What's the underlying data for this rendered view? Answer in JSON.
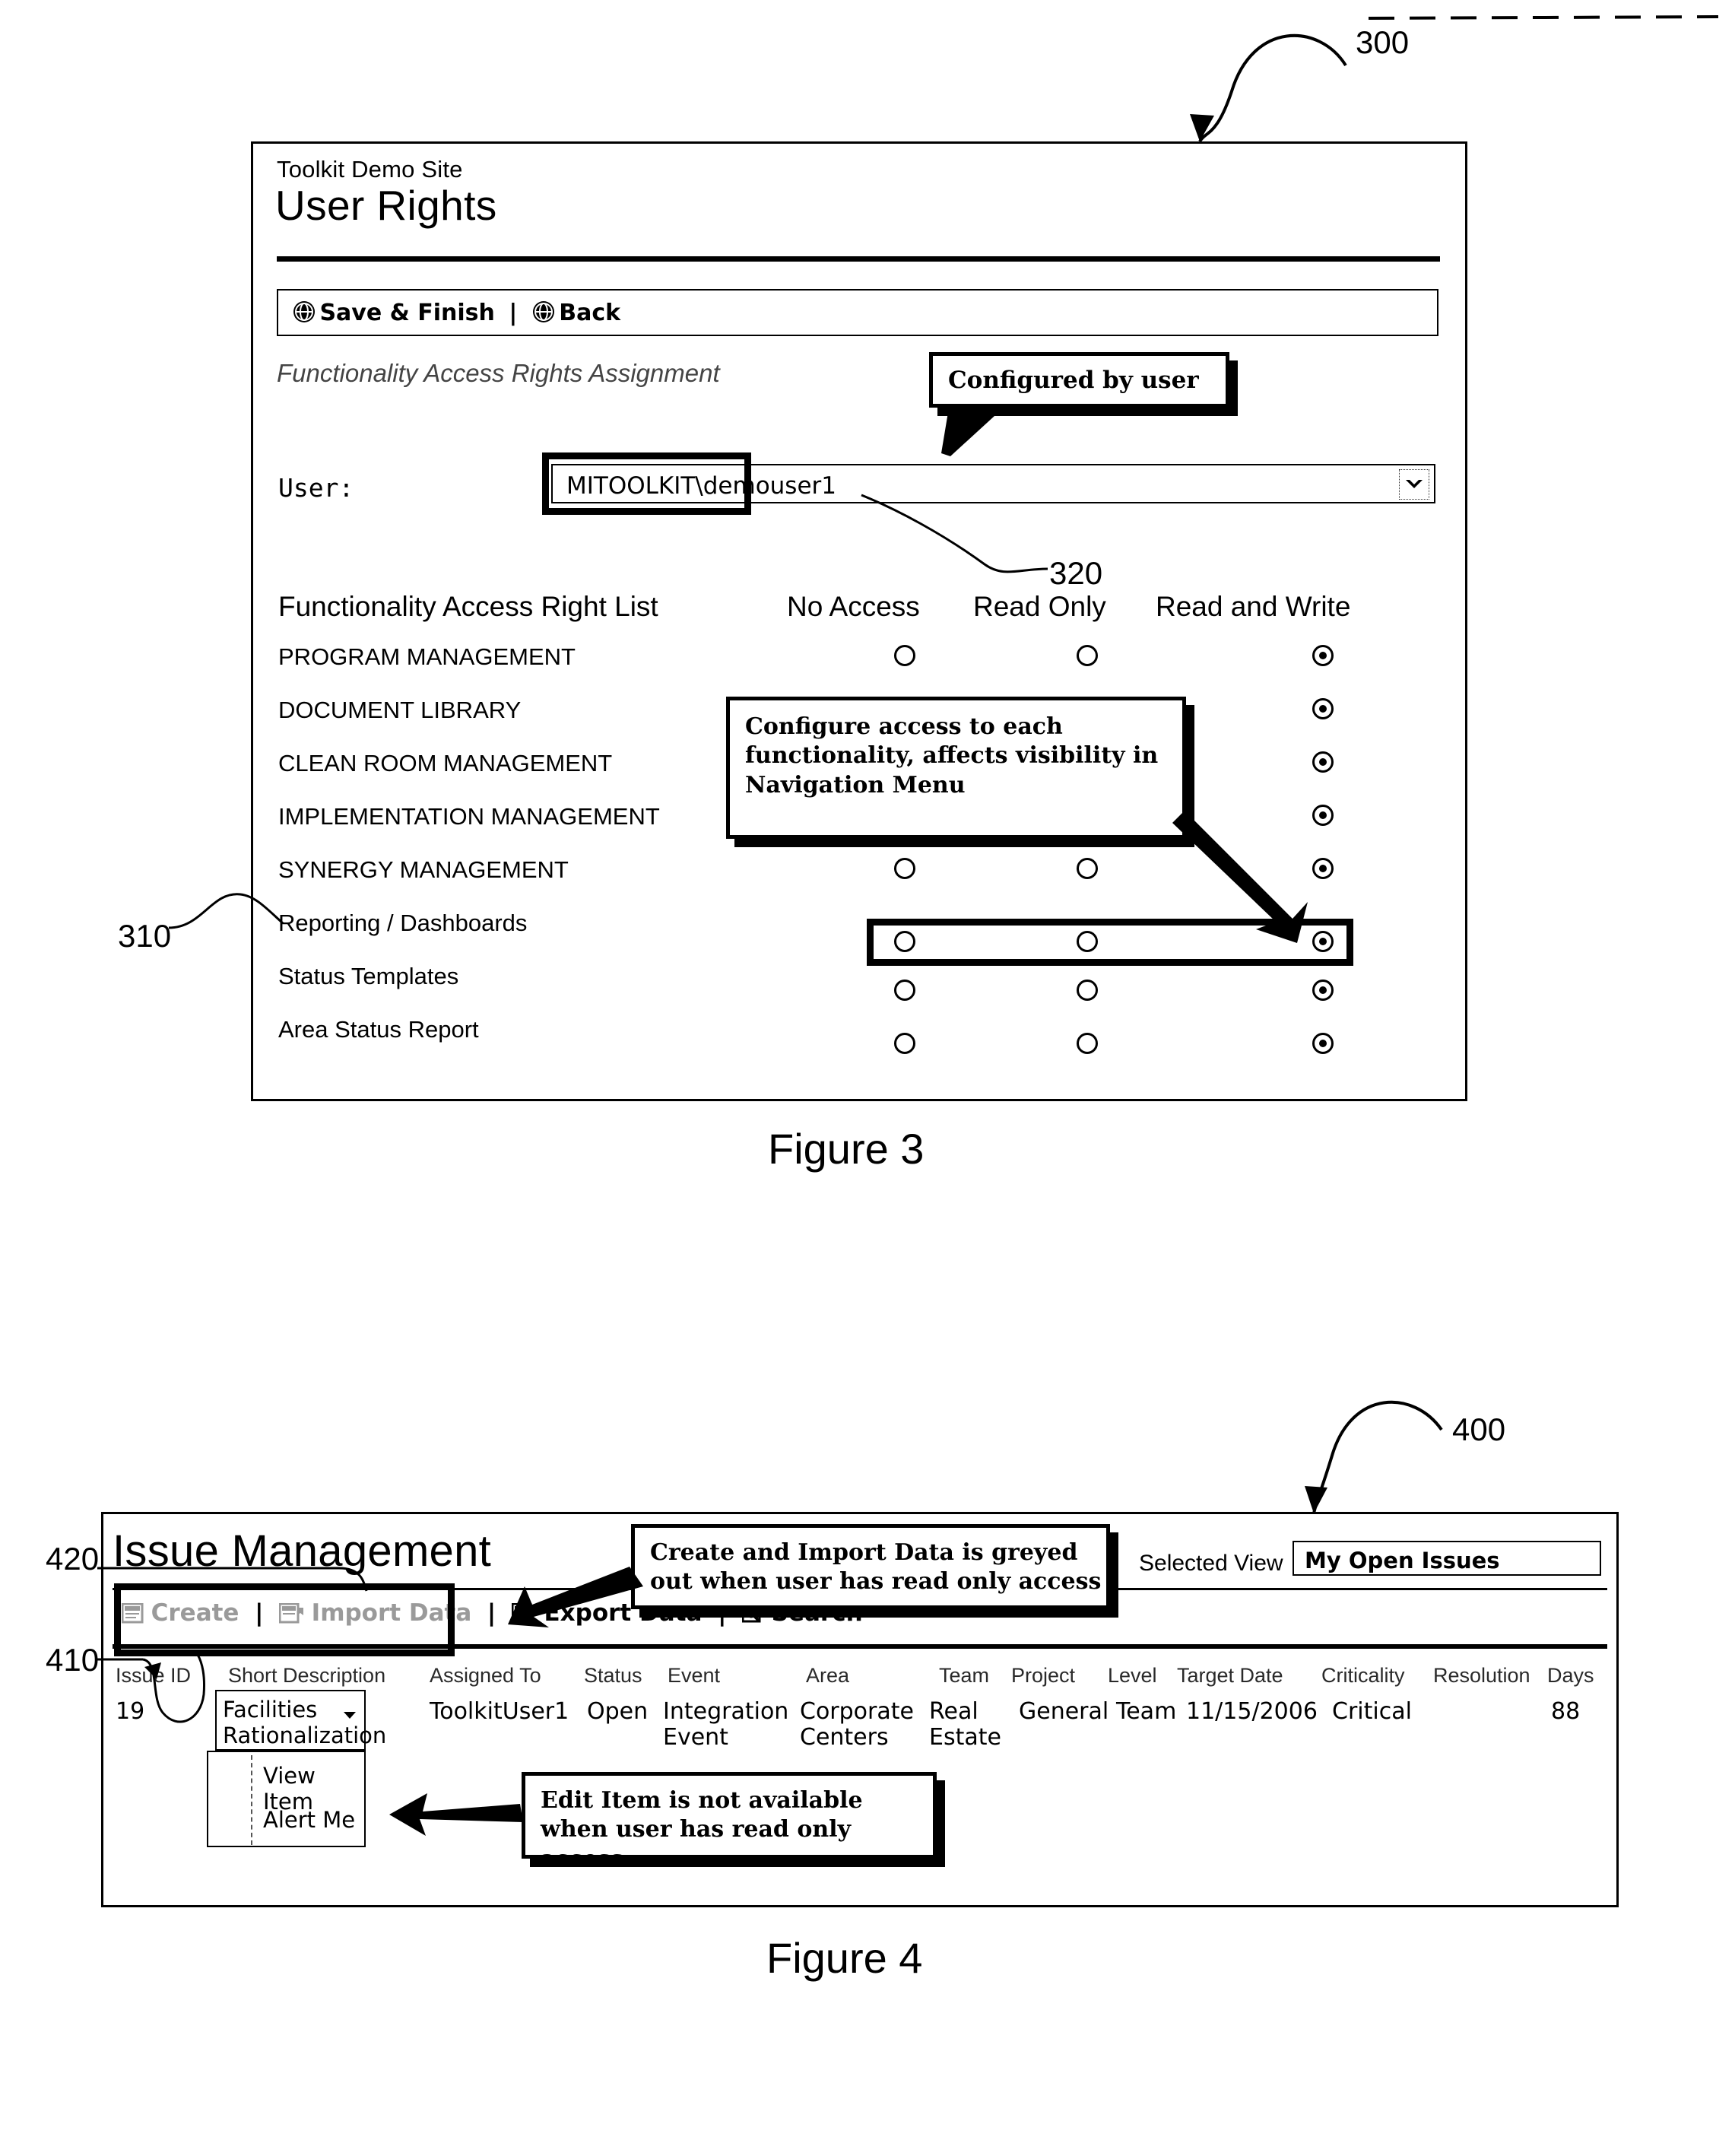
{
  "figure3": {
    "ref": "300",
    "caption": "Figure 3",
    "site_name": "Toolkit Demo Site",
    "page_title": "User Rights",
    "toolbar": {
      "save_label": "Save & Finish",
      "separator": "|",
      "back_label": "Back"
    },
    "section_subtitle": "Functionality Access Rights Assignment",
    "user": {
      "label": "User:",
      "selected_value": "MITOOLKIT\\demouser1",
      "ref": "320"
    },
    "list": {
      "header": "Functionality Access Right List",
      "ref": "310",
      "columns": [
        "No Access",
        "Read Only",
        "Read and Write"
      ],
      "rows": [
        {
          "label": "PROGRAM MANAGEMENT",
          "selected": "Read and Write"
        },
        {
          "label": "DOCUMENT LIBRARY",
          "selected": "Read and Write"
        },
        {
          "label": "CLEAN ROOM MANAGEMENT",
          "selected": "Read and Write"
        },
        {
          "label": "IMPLEMENTATION MANAGEMENT",
          "selected": "Read and Write"
        },
        {
          "label": "SYNERGY MANAGEMENT",
          "selected": "Read and Write"
        },
        {
          "label": "Reporting / Dashboards",
          "selected": "Read and Write",
          "highlighted": true
        },
        {
          "label": "Status Templates",
          "selected": "Read and Write"
        },
        {
          "label": "Area Status Report",
          "selected": "Read and Write"
        }
      ]
    },
    "callouts": {
      "configured_by_user": "Configured by user",
      "configure_access": "Configure access to each functionality, affects visibility in Navigation Menu"
    }
  },
  "figure4": {
    "ref": "400",
    "caption": "Figure 4",
    "page_title": "Issue Management",
    "title_ref": "420",
    "toolbar_ref": "410",
    "selected_view": {
      "label": "Selected View",
      "value": "My Open Issues"
    },
    "toolbar": {
      "create_label": "Create",
      "import_label": "Import Data",
      "export_label": "Export Data",
      "search_label": "Search",
      "separator": "|"
    },
    "table": {
      "columns": [
        "Issue ID",
        "Short Description",
        "Assigned To",
        "Status",
        "Event",
        "Area",
        "Team",
        "Project",
        "Level",
        "Target Date",
        "Criticality",
        "Resolution",
        "Days"
      ],
      "row": {
        "issue_id": "19",
        "short_description": "Facilities Rationalization",
        "assigned_to": "ToolkitUser1",
        "status": "Open",
        "event": "Integration Event",
        "area": "Corporate Centers",
        "team": "Real Estate",
        "project": "General",
        "level": "Team",
        "target_date": "11/15/2006",
        "criticality": "Critical",
        "resolution": "",
        "days": "88"
      }
    },
    "context_menu": {
      "items": [
        "View Item",
        "Alert Me"
      ]
    },
    "callouts": {
      "greyed_out": "Create and Import Data is greyed out when user has read only access",
      "edit_item": "Edit Item is not available when user has read only access"
    }
  }
}
